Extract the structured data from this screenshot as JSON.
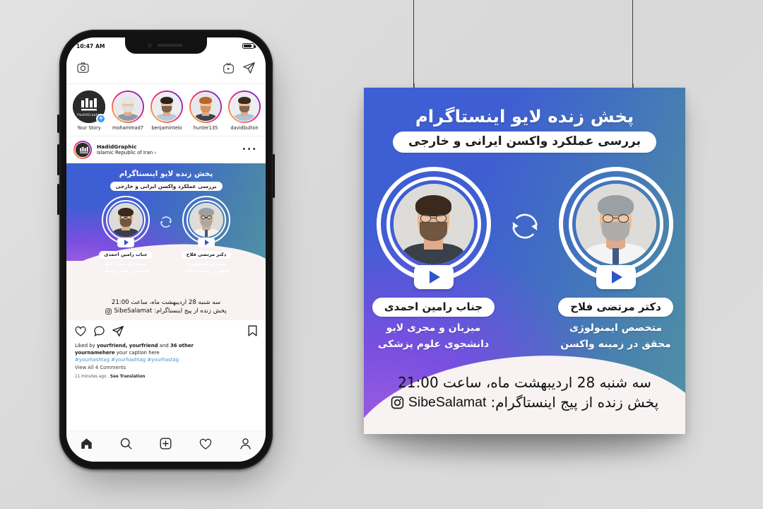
{
  "colors": {
    "background": "#dcdcdc",
    "poster_blue": "#3e5fd4",
    "poster_teal": "#4f91a4",
    "poster_purple": "#8b5fd9",
    "poster_cream": "#f8f2f2",
    "play_blue": "#2f54c8",
    "link_blue": "#4a8fd4"
  },
  "phone": {
    "status": {
      "time": "10:47 AM",
      "battery_icon": "battery-icon"
    },
    "topbar": {
      "camera_icon": "camera-icon",
      "igtv_icon": "igtv-icon",
      "direct_icon": "paper-plane-icon"
    },
    "stories": [
      {
        "name": "Your Story",
        "own": true,
        "badge": "+"
      },
      {
        "name": "mohammad7",
        "own": false
      },
      {
        "name": "benjamintelo",
        "own": false
      },
      {
        "name": "hunter135",
        "own": false
      },
      {
        "name": "davidbulton",
        "own": false
      }
    ],
    "post": {
      "username": "HadidGraphic",
      "location": "Islamic Republic of Iran ›",
      "more_icon": "ellipsis-icon",
      "actions": {
        "like_icon": "heart-icon",
        "comment_icon": "comment-icon",
        "share_icon": "paper-plane-icon",
        "save_icon": "bookmark-icon"
      },
      "likes_prefix": "Liked by ",
      "likes_names": "yourfriend, yourfriend",
      "likes_mid": " and ",
      "likes_count": "36 other",
      "caption_user": "yournamehere",
      "caption_text": " your caption here",
      "hashtags": "#yourhashtag #yourhashtag #yourhastag",
      "view_comments": "View All 4 Comments",
      "time_ago": "11 minutes ago . ",
      "see_translation": "See Translation"
    },
    "tabbar": [
      {
        "icon": "home-icon",
        "active": true
      },
      {
        "icon": "search-icon",
        "active": false
      },
      {
        "icon": "add-post-icon",
        "active": false
      },
      {
        "icon": "activity-heart-icon",
        "active": false
      },
      {
        "icon": "profile-icon",
        "active": false
      }
    ]
  },
  "poster": {
    "title": "پخش زنده لایو اینستاگرام",
    "subtitle": "بررسی عملکرد واکسن ایرانی و خارجی",
    "sync_icon": "sync-arrows-icon",
    "guests": [
      {
        "name": "دکتر مرتضی فلاح",
        "role1": "متخصص ایمنولوژی",
        "role2": "محقق در زمینه واکسن",
        "play_icon": "play-icon"
      },
      {
        "name": "جناب رامین احمدی",
        "role1": "میزبان و مجری لایو",
        "role2": "دانشجوی علوم پزشکی",
        "play_icon": "play-icon"
      }
    ],
    "date_line": "سه شنبه 28 اردیبهشت ماه، ساعت 21:00",
    "handle_label": "پخش زنده از پیج اینستاگرام:",
    "handle": "SibeSalamat",
    "instagram_icon": "instagram-icon",
    "clip_icon": "binder-clip-icon"
  }
}
